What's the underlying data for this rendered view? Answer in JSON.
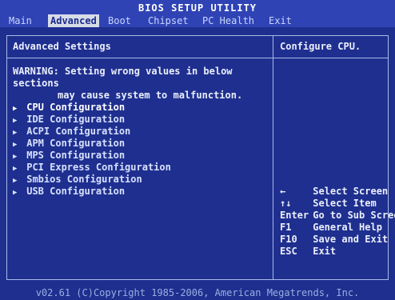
{
  "header": {
    "title": "BIOS SETUP UTILITY",
    "menu": [
      {
        "label": "Main"
      },
      {
        "label": "Advanced"
      },
      {
        "label": "Boot"
      },
      {
        "label": "Chipset"
      },
      {
        "label": "PC Health"
      },
      {
        "label": "Exit"
      }
    ]
  },
  "main": {
    "section_title": "Advanced Settings",
    "warning": {
      "line1": "WARNING: Setting wrong values in below sections",
      "line2": "may cause system to malfunction."
    },
    "items": [
      {
        "label": "CPU Configuration"
      },
      {
        "label": "IDE Configuration"
      },
      {
        "label": "ACPI Configuration"
      },
      {
        "label": "APM Configuration"
      },
      {
        "label": "MPS Configuration"
      },
      {
        "label": "PCI Express Configuration"
      },
      {
        "label": "Smbios Configuration"
      },
      {
        "label": "USB Configuration"
      }
    ]
  },
  "help": {
    "text": "Configure CPU.",
    "keys": [
      {
        "key": "←",
        "desc": "Select Screen"
      },
      {
        "key": "↑↓",
        "desc": "Select Item"
      },
      {
        "key": "Enter",
        "desc": "Go to Sub Screen"
      },
      {
        "key": "F1",
        "desc": "General Help"
      },
      {
        "key": "F10",
        "desc": "Save and Exit"
      },
      {
        "key": "ESC",
        "desc": "Exit"
      }
    ]
  },
  "footer": {
    "copyright": "v02.61 (C)Copyright 1985-2006, American Megatrends, Inc."
  },
  "colors": {
    "background": "#1f2f8f",
    "title_bar": "#2f43b5",
    "active_tab": "#d7dde8",
    "text": "#e9eefc"
  }
}
